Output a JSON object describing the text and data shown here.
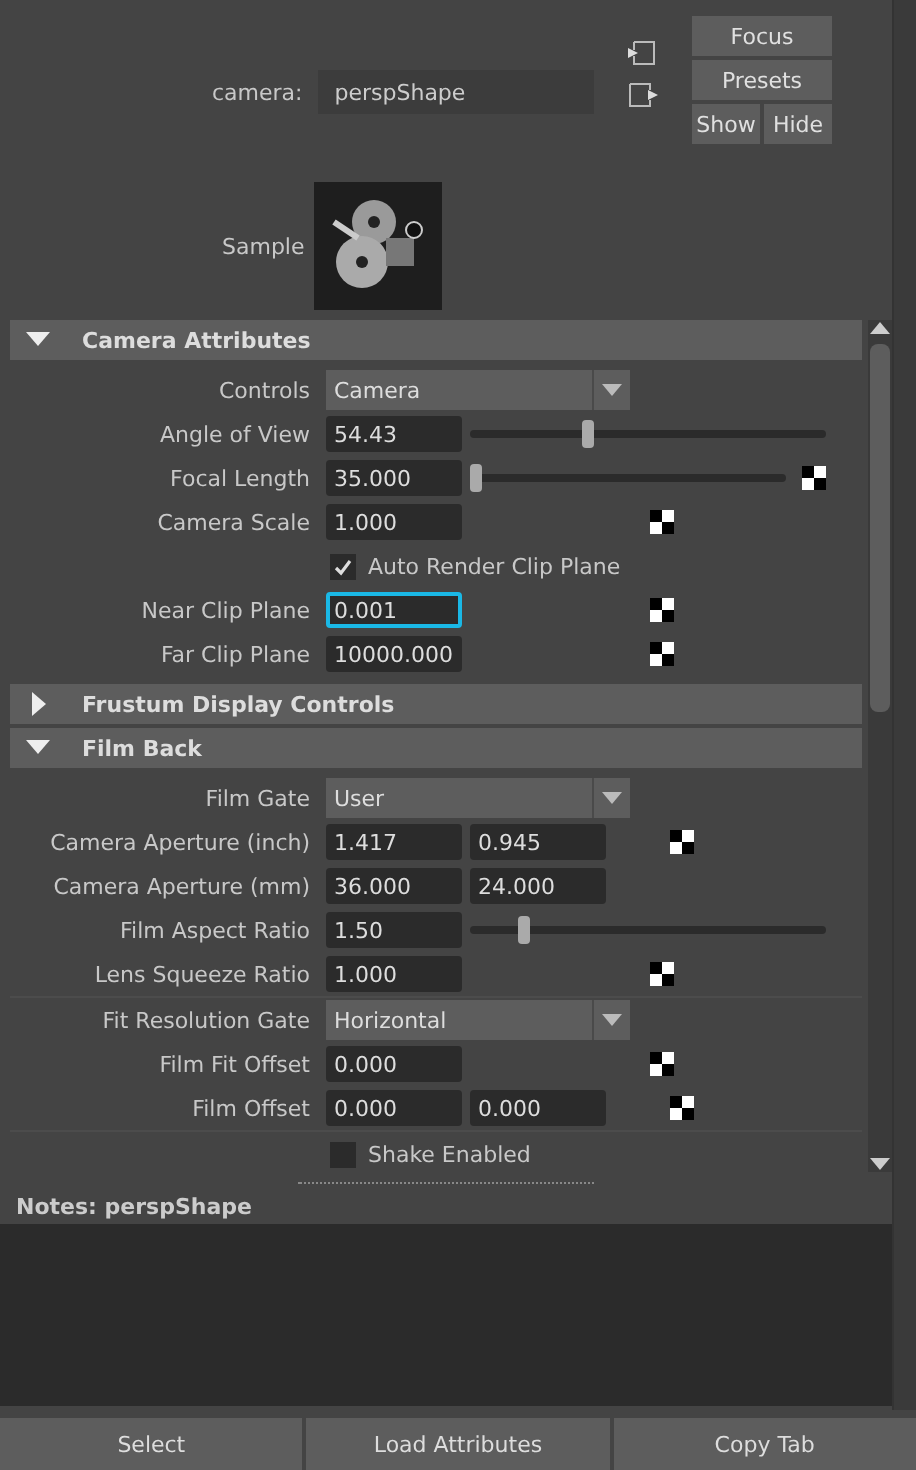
{
  "camera": {
    "label": "camera:",
    "value": "perspShape"
  },
  "side_buttons": [
    "Focus",
    "Presets"
  ],
  "show_hide": [
    "Show",
    "Hide"
  ],
  "sample": {
    "label": "Sample"
  },
  "sections": [
    {
      "title": "Camera Attributes",
      "expanded": true,
      "rows": [
        {
          "kind": "dropdown",
          "label": "Controls",
          "value": "Camera"
        },
        {
          "kind": "slider",
          "label": "Angle of View",
          "value": "54.43",
          "level": 0.33,
          "map": false,
          "focused": false
        },
        {
          "kind": "slider",
          "label": "Focal Length",
          "value": "35.000",
          "level": 0.02,
          "map": true,
          "focused": false
        },
        {
          "kind": "field",
          "label": "Camera Scale",
          "value": "1.000",
          "map": true,
          "focused": false
        },
        {
          "kind": "checkbox",
          "label": "Auto Render Clip Plane",
          "checked": true
        },
        {
          "kind": "field",
          "label": "Near Clip Plane",
          "value": "0.001",
          "map": true,
          "focused": true
        },
        {
          "kind": "field",
          "label": "Far Clip Plane",
          "value": "10000.000",
          "map": true,
          "focused": false
        }
      ]
    },
    {
      "title": "Frustum Display Controls",
      "expanded": false
    },
    {
      "title": "Film Back",
      "expanded": true,
      "rows": [
        {
          "kind": "dropdown",
          "label": "Film Gate",
          "value": "User"
        },
        {
          "kind": "pair",
          "label": "Camera Aperture (inch)",
          "values": [
            "1.417",
            "0.945"
          ],
          "map": true
        },
        {
          "kind": "pair",
          "label": "Camera Aperture (mm)",
          "values": [
            "36.000",
            "24.000"
          ],
          "map": false
        },
        {
          "kind": "slider",
          "label": "Film Aspect Ratio",
          "value": "1.50",
          "level": 0.15,
          "map": false,
          "focused": false
        },
        {
          "kind": "field",
          "label": "Lens Squeeze Ratio",
          "value": "1.000",
          "map": true,
          "focused": false
        },
        {
          "kind": "dropdown",
          "label": "Fit Resolution Gate",
          "value": "Horizontal",
          "divider": true
        },
        {
          "kind": "field",
          "label": "Film Fit Offset",
          "value": "0.000",
          "map": true,
          "focused": false
        },
        {
          "kind": "pair",
          "label": "Film Offset",
          "values": [
            "0.000",
            "0.000"
          ],
          "map": true
        },
        {
          "kind": "checkbox",
          "label": "Shake Enabled",
          "checked": false,
          "divider": true
        }
      ]
    }
  ],
  "notes": {
    "label": "Notes:  perspShape"
  },
  "buttons": [
    "Select",
    "Load Attributes",
    "Copy Tab"
  ]
}
